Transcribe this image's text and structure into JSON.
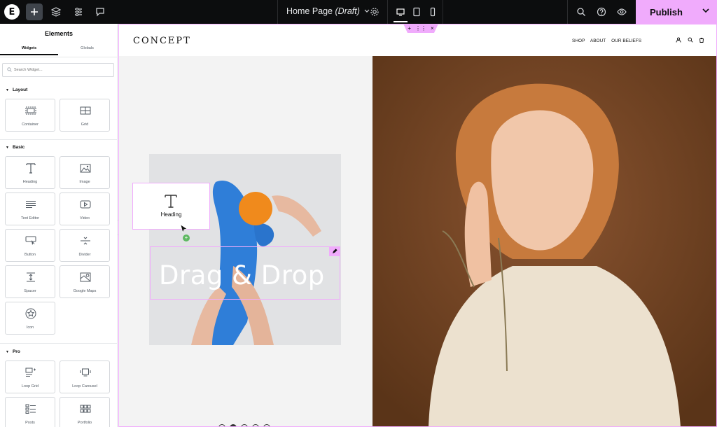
{
  "topbar": {
    "logo_letter": "E",
    "page_name": "Home Page",
    "page_status": "(Draft)",
    "publish_label": "Publish",
    "colors": {
      "bg": "#0c0d0e",
      "accent": "#f0abfc"
    }
  },
  "sidebar": {
    "title": "Elements",
    "tabs": [
      {
        "label": "Widgets"
      },
      {
        "label": "Globals"
      }
    ],
    "search_placeholder": "Search Widget...",
    "sections": {
      "layout": {
        "label": "Layout",
        "widgets": [
          {
            "label": "Container",
            "icon": "container-icon"
          },
          {
            "label": "Grid",
            "icon": "grid-icon"
          }
        ]
      },
      "basic": {
        "label": "Basic",
        "widgets": [
          {
            "label": "Heading",
            "icon": "heading-icon"
          },
          {
            "label": "Image",
            "icon": "image-icon"
          },
          {
            "label": "Text Editor",
            "icon": "text-editor-icon"
          },
          {
            "label": "Video",
            "icon": "video-icon"
          },
          {
            "label": "Button",
            "icon": "button-icon"
          },
          {
            "label": "Divider",
            "icon": "divider-icon"
          },
          {
            "label": "Spacer",
            "icon": "spacer-icon"
          },
          {
            "label": "Google Maps",
            "icon": "map-icon"
          },
          {
            "label": "Icon",
            "icon": "star-icon"
          }
        ]
      },
      "pro": {
        "label": "Pro",
        "widgets": [
          {
            "label": "Loop Grid",
            "icon": "loop-grid-icon"
          },
          {
            "label": "Loop Carousel",
            "icon": "loop-carousel-icon"
          },
          {
            "label": "Posts",
            "icon": "posts-icon"
          },
          {
            "label": "Portfolio",
            "icon": "portfolio-icon"
          }
        ]
      }
    }
  },
  "site": {
    "logo": "CONCEPT",
    "nav": [
      "SHOP",
      "ABOUT",
      "OUR BELIEFS"
    ],
    "hero_title": "Drag & Drop",
    "drag_widget_label": "Heading",
    "carousel_dots": 5,
    "carousel_active": 2
  }
}
